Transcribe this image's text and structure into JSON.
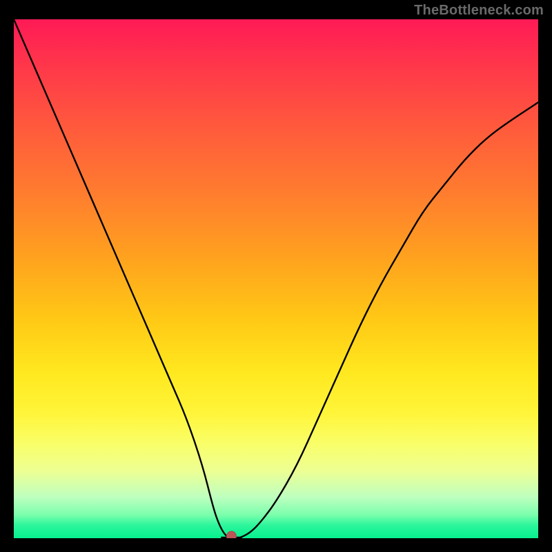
{
  "watermark": "TheBottleneck.com",
  "chart_data": {
    "type": "line",
    "title": "",
    "xlabel": "",
    "ylabel": "",
    "xlim": [
      0,
      100
    ],
    "ylim": [
      0,
      100
    ],
    "grid": false,
    "legend": null,
    "series": [
      {
        "name": "bottleneck-curve",
        "x": [
          0,
          3,
          6,
          9,
          12,
          15,
          18,
          21,
          24,
          27,
          30,
          33,
          36,
          38,
          39,
          40,
          41,
          42,
          43,
          45,
          47,
          50,
          54,
          58,
          62,
          66,
          70,
          74,
          78,
          82,
          86,
          90,
          94,
          100
        ],
        "values": [
          100,
          93,
          86,
          79,
          72,
          65,
          58,
          51,
          44,
          37,
          30,
          23,
          14,
          6,
          3,
          1,
          0,
          0,
          0,
          1,
          3,
          7,
          14,
          23,
          32,
          41,
          49,
          56,
          63,
          68,
          73,
          77,
          80,
          84
        ]
      }
    ],
    "marker": {
      "x": 41.5,
      "y": 0,
      "color": "#bb5556"
    },
    "colors": {
      "curve": "#000000",
      "marker": "#bb5556",
      "gradient_top": "#ff1a56",
      "gradient_mid": "#ffe81f",
      "gradient_bottom": "#06f08f",
      "background": "#000000",
      "watermark": "#6a6a6a"
    }
  }
}
